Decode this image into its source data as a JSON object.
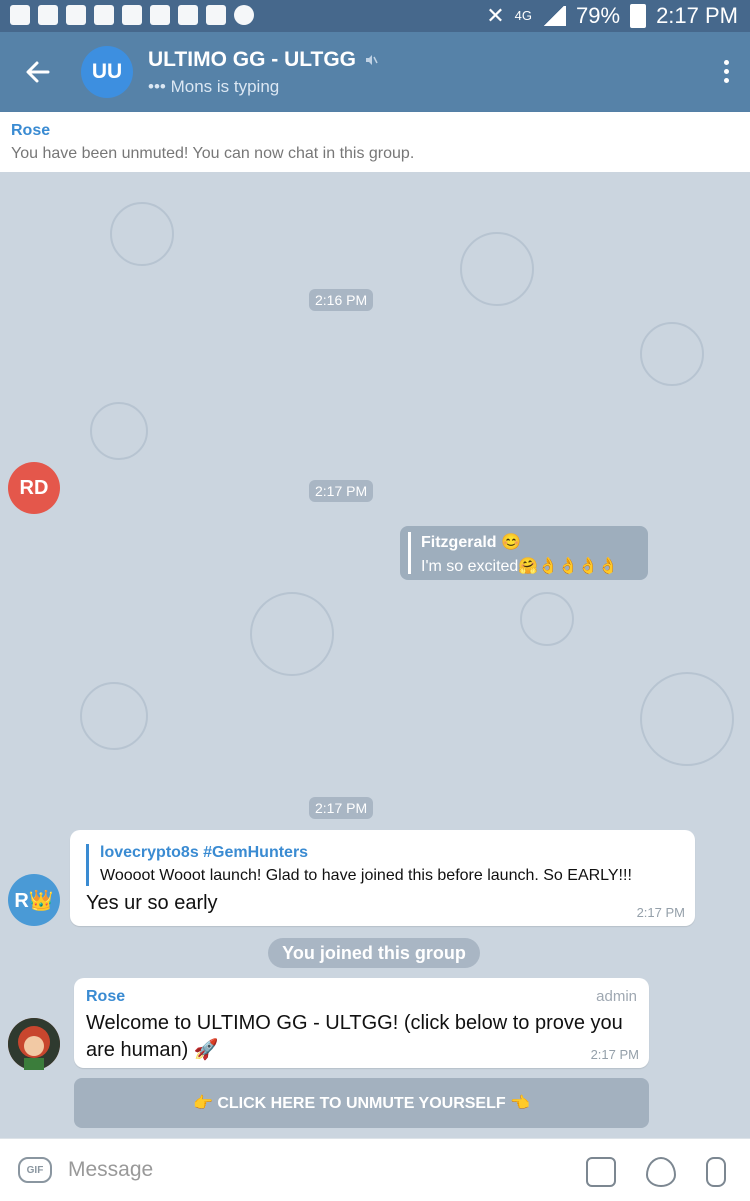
{
  "status_bar": {
    "time": "2:17 PM",
    "battery": "79%",
    "network": "4G"
  },
  "app_bar": {
    "avatar_initials": "UU",
    "title": "ULTIMO GG - ULTGG",
    "subtitle": "••• Mons is typing"
  },
  "pinned": {
    "sender": "Rose",
    "text": "You have been unmuted! You can now chat in this group."
  },
  "messages": [
    {
      "type": "date",
      "label": "2:16 PM"
    },
    {
      "type": "avatar",
      "initials": "RD",
      "color": "#e4574b"
    },
    {
      "type": "date",
      "label": "2:17 PM"
    },
    {
      "type": "reply_preview",
      "name": "Fitzgerald 😊",
      "text": "I'm so excited🤗👌👌👌👌"
    },
    {
      "type": "date",
      "label": "2:17 PM"
    },
    {
      "type": "message",
      "avatar": "R👑",
      "quote_name": "lovecrypto8s #GemHunters",
      "quote_text": "Woooot Wooot launch! Glad to have joined this before launch. So EARLY!!!",
      "text": "Yes ur so early",
      "time": "2:17 PM"
    },
    {
      "type": "service",
      "text": "You joined this group"
    },
    {
      "type": "message",
      "sender": "Rose",
      "role": "admin",
      "text": "Welcome to ULTIMO GG - ULTGG! (click below to prove you are human) 🚀",
      "time": "2:17 PM"
    }
  ],
  "inline_button": {
    "label": "👉 CLICK HERE TO UNMUTE YOURSELF 👈"
  },
  "composer": {
    "placeholder": "Message",
    "gif_label": "GIF"
  },
  "colors": {
    "status_bar": "#46688c",
    "app_bar": "#5682a8",
    "accent_blue": "#3a8bd2",
    "chat_bg": "#cbd5df"
  }
}
